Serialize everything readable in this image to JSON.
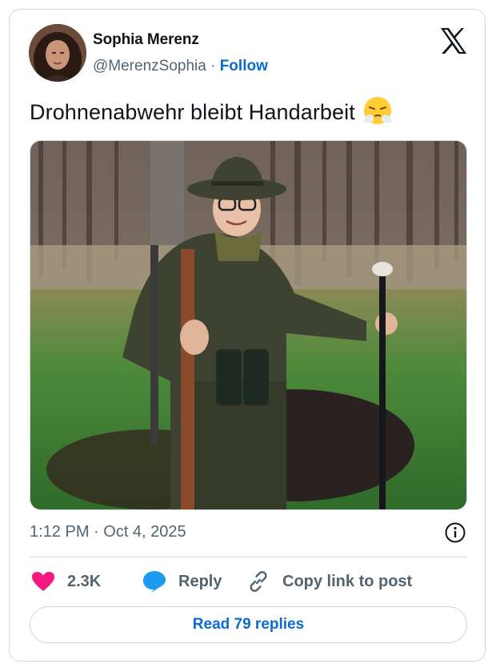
{
  "author": {
    "name": "Sophia Merenz",
    "handle": "@MerenzSophia",
    "separator": "·",
    "follow_label": "Follow"
  },
  "tweet": {
    "text": "Drohnenabwehr bleibt Handarbeit",
    "emoji": "face-with-steam-from-nose-emoji",
    "timestamp": "1:12 PM · Oct 4, 2025"
  },
  "actions": {
    "like_count": "2.3K",
    "reply_label": "Reply",
    "copy_link_label": "Copy link to post"
  },
  "read_replies_label": "Read 79 replies",
  "icons": [
    "x-logo-icon",
    "info-icon",
    "heart-icon",
    "reply-bubble-icon",
    "link-icon"
  ],
  "colors": {
    "accent_blue": "#0a6bd3",
    "like_pink": "#f91880",
    "reply_blue": "#1d9bf0",
    "secondary_text": "#536471",
    "border": "#cfd9de"
  }
}
